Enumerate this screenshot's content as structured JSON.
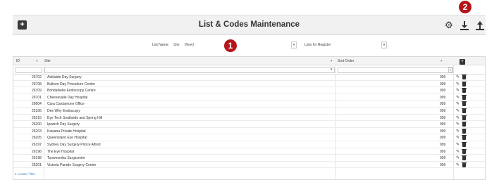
{
  "callouts": {
    "one": "1",
    "two": "2"
  },
  "header": {
    "title": "List & Codes Maintenance"
  },
  "list_controls": {
    "list_name_label": "List Name:",
    "list_name_value": "Site",
    "new_tag": "[New]",
    "lists_for_register_label": "Lists for Register"
  },
  "table": {
    "columns": {
      "id": "ID",
      "site": "Site",
      "sort_order": "Sort Order"
    },
    "rows": [
      {
        "id": "26702",
        "site": "Adelaide Day Surgery",
        "sort": "999"
      },
      {
        "id": "26708",
        "site": "Bulleen Day Procedure Centre",
        "sort": "999"
      },
      {
        "id": "26709",
        "site": "Bondaibelle Endoscopy Centre",
        "sort": "999"
      },
      {
        "id": "26701",
        "site": "Cheesevalle Day Hospital",
        "sort": "999"
      },
      {
        "id": "26604",
        "site": "Cara Cardamone Office",
        "sort": "999"
      },
      {
        "id": "25106",
        "site": "Dee Why Endoscopy",
        "sort": "999"
      },
      {
        "id": "26215",
        "site": "Eye Tech Southside and Spring Hill",
        "sort": "999"
      },
      {
        "id": "26200",
        "site": "Ipswich Day Surgery",
        "sort": "999"
      },
      {
        "id": "26203",
        "site": "Kawana Private Hospital",
        "sort": "999"
      },
      {
        "id": "26205",
        "site": "Queensland Eye Hospital",
        "sort": "999"
      },
      {
        "id": "26197",
        "site": "Sydney Day Surgery Prince Alfred",
        "sort": "999"
      },
      {
        "id": "26196",
        "site": "The Eye Hospital",
        "sort": "999"
      },
      {
        "id": "26198",
        "site": "Toowoomba Surgicentre",
        "sort": "999"
      },
      {
        "id": "26201",
        "site": "Victoria Parade Surgery Centre",
        "sort": "999"
      }
    ],
    "footer": "▾ Locate / filter"
  }
}
